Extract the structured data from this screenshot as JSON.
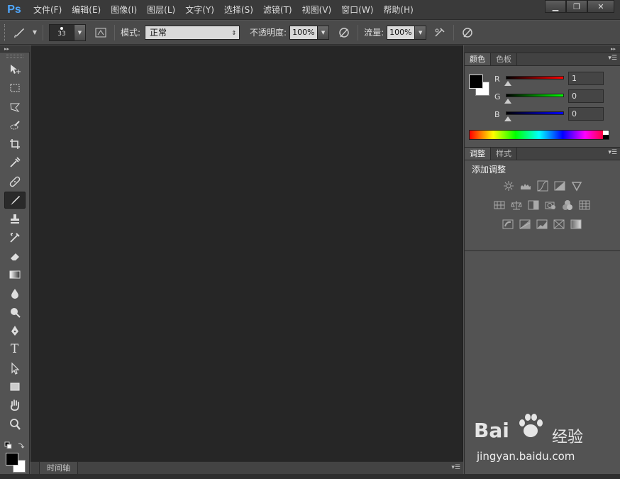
{
  "app": {
    "logo": "Ps"
  },
  "menu": [
    "文件(F)",
    "编辑(E)",
    "图像(I)",
    "图层(L)",
    "文字(Y)",
    "选择(S)",
    "滤镜(T)",
    "视图(V)",
    "窗口(W)",
    "帮助(H)"
  ],
  "window_controls": {
    "minimize": "▁",
    "maximize": "❐",
    "close": "✕"
  },
  "options": {
    "brush_size": "33",
    "mode_label": "模式:",
    "mode_value": "正常",
    "opacity_label": "不透明度:",
    "opacity_value": "100%",
    "flow_label": "流量:",
    "flow_value": "100%"
  },
  "tools": [
    {
      "name": "move-tool",
      "icon": "move-icon"
    },
    {
      "name": "marquee-tool",
      "icon": "marquee-icon"
    },
    {
      "name": "lasso-tool",
      "icon": "lasso-icon"
    },
    {
      "name": "quick-select-tool",
      "icon": "quick-select-icon"
    },
    {
      "name": "crop-tool",
      "icon": "crop-icon"
    },
    {
      "name": "eyedropper-tool",
      "icon": "eyedropper-icon"
    },
    {
      "name": "healing-tool",
      "icon": "bandage-icon"
    },
    {
      "name": "brush-tool",
      "icon": "brush-icon",
      "active": true
    },
    {
      "name": "stamp-tool",
      "icon": "stamp-icon"
    },
    {
      "name": "history-brush-tool",
      "icon": "history-brush-icon"
    },
    {
      "name": "eraser-tool",
      "icon": "eraser-icon"
    },
    {
      "name": "gradient-tool",
      "icon": "gradient-icon"
    },
    {
      "name": "blur-tool",
      "icon": "droplet-icon"
    },
    {
      "name": "dodge-tool",
      "icon": "dodge-icon"
    },
    {
      "name": "pen-tool",
      "icon": "pen-icon"
    },
    {
      "name": "type-tool",
      "icon": "type-icon",
      "glyph": "T"
    },
    {
      "name": "path-select-tool",
      "icon": "arrow-icon"
    },
    {
      "name": "shape-tool",
      "icon": "rectangle-icon"
    },
    {
      "name": "hand-tool",
      "icon": "hand-icon"
    },
    {
      "name": "zoom-tool",
      "icon": "zoom-icon"
    }
  ],
  "colors": {
    "foreground": "#000000",
    "background": "#ffffff"
  },
  "timeline": {
    "tab": "时间轴"
  },
  "color_panel": {
    "tabs": [
      "颜色",
      "色板"
    ],
    "r_label": "R",
    "r_value": "1",
    "g_label": "G",
    "g_value": "0",
    "b_label": "B",
    "b_value": "0"
  },
  "adjust_panel": {
    "tabs": [
      "调整",
      "样式"
    ],
    "title": "添加调整"
  },
  "watermark": {
    "brand": "Bai",
    "brand2": "经验",
    "url": "jingyan.baidu.com"
  }
}
